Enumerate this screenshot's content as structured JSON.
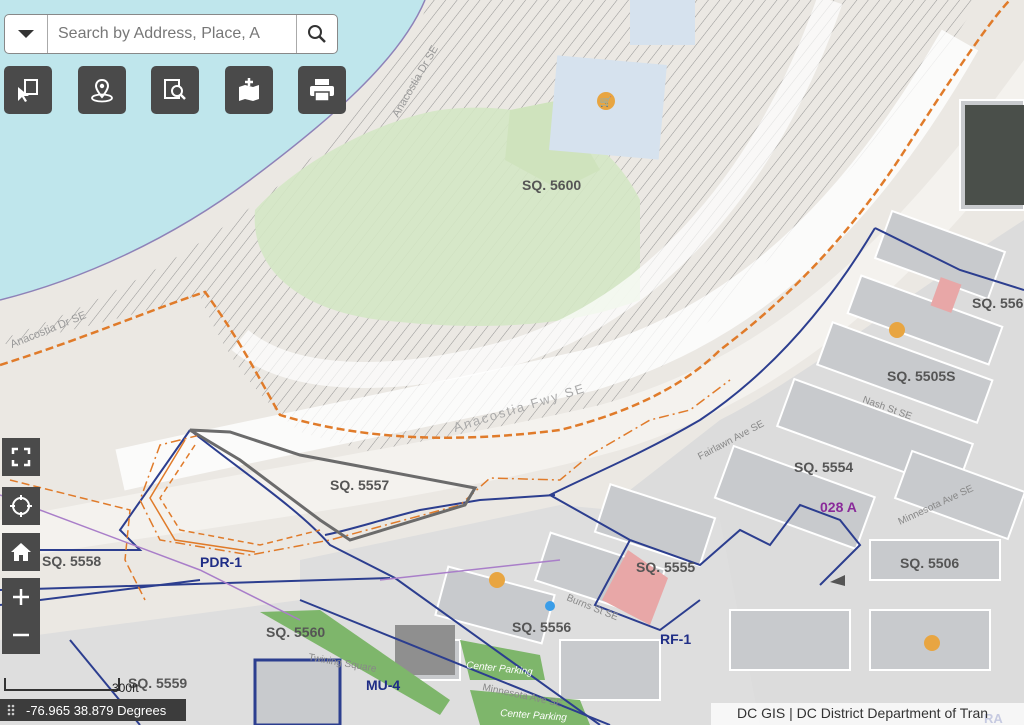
{
  "search": {
    "placeholder": "Search by Address, Place, A"
  },
  "toolbar": {
    "select_tool": "select-parcel-icon",
    "locate_tool": "location-pin-icon",
    "identify_tool": "document-search-icon",
    "measure_tool": "map-add-icon",
    "print_tool": "printer-icon"
  },
  "map_controls": {
    "fullscreen": "fullscreen-icon",
    "locate": "crosshair-icon",
    "home": "home-icon",
    "zoom_in": "+",
    "zoom_out": "−"
  },
  "labels": {
    "sq5600": "SQ. 5600",
    "sq5557": "SQ. 5557",
    "sq5558": "SQ. 5558",
    "sq5560": "SQ. 5560",
    "sq5559": "SQ. 5559",
    "sq5556": "SQ. 5556",
    "sq5555": "SQ. 5555",
    "sq5554": "SQ. 5554",
    "sq5506": "SQ. 5506",
    "sq5505s": "SQ. 5505S",
    "sq556x": "SQ. 556",
    "zone_pdr1": "PDR-1",
    "zone_mu4": "MU-4",
    "zone_rf1": "RF-1",
    "anc_028a": "028 A",
    "zone_ra": "RA",
    "st_anacostia_dr_1": "Anacostia Dr SE",
    "st_anacostia_dr_2": "Anacostia Dr SE",
    "st_anacostia_fwy": "Anacostia Fwy SE",
    "st_fairlawn": "Fairlawn Ave SE",
    "st_nash": "Nash St SE",
    "st_minnesota_1": "Minnesota Ave SE",
    "st_minnesota_2": "Minnesota Ave SE",
    "st_burns": "Burns St SE",
    "st_twining": "Twining Square",
    "st_center_parking_1": "Center Parking",
    "st_center_parking_2": "Center Parking"
  },
  "scale": {
    "label": "300ft"
  },
  "coordinates": {
    "text": "-76.965 38.879 Degrees"
  },
  "attribution": {
    "text": "DC GIS | DC District Department of Tran"
  },
  "colors": {
    "water": "#bfe6ec",
    "park": "#d4e7c4",
    "zoning_boundary": "#2c3e8f",
    "anc_boundary": "#e07b2a",
    "building": "#c4c6ca",
    "highlight_parcel": "#e8a7a7",
    "label_zone": "#1f2d86",
    "label_anc": "#8a2a9a"
  }
}
